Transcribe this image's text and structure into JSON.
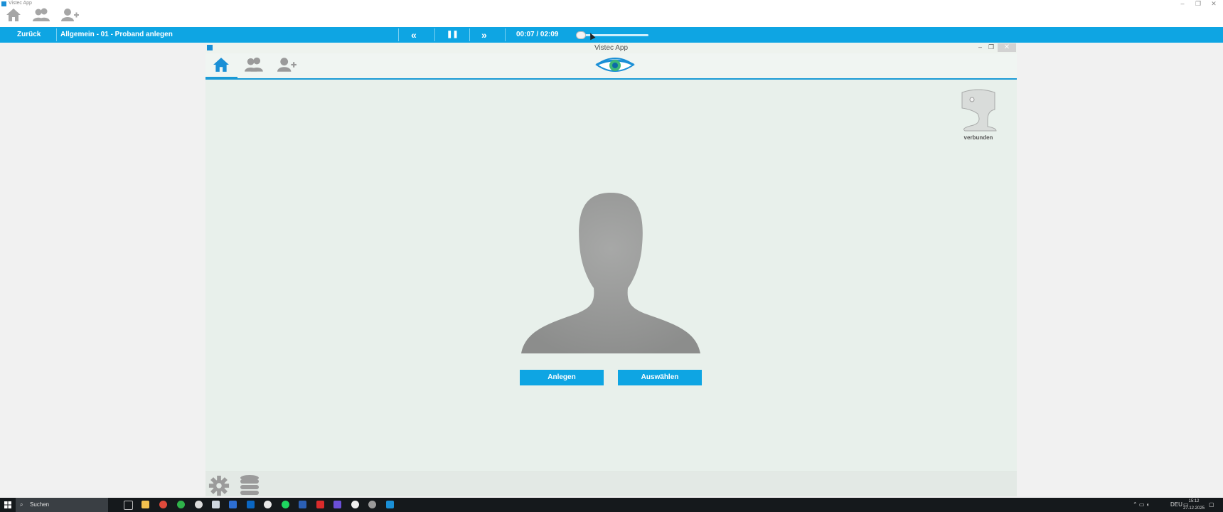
{
  "window": {
    "title": "Vistec App",
    "minimize": "–",
    "maximize": "❐",
    "close": "✕"
  },
  "outer_nav": {
    "home": "home-icon",
    "users": "users-icon",
    "add_user": "add-user-icon"
  },
  "player": {
    "back_label": "Zurück",
    "breadcrumb": "Allgemein - 01 - Proband anlegen",
    "rewind": "«",
    "pause": "❚❚",
    "forward": "»",
    "time": "00:07 / 02:09",
    "progress": 0.054
  },
  "inner_window": {
    "title": "Vistec App",
    "minimize": "–",
    "maximize": "❐",
    "close": "✕"
  },
  "device": {
    "status": "verbunden"
  },
  "actions": {
    "create": "Anlegen",
    "select": "Auswählen"
  },
  "bottom": {
    "settings": "gear-icon",
    "database": "database-icon"
  },
  "taskbar": {
    "search_placeholder": "Suchen",
    "language": "DEU",
    "time": "15:12",
    "date": "27.12.2025"
  },
  "colors": {
    "accent": "#0ea5e3",
    "background": "#e8f0eb",
    "taskbar": "#15191c"
  }
}
